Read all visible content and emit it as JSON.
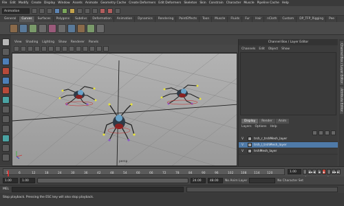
{
  "menubar": [
    "File",
    "Edit",
    "Modify",
    "Create",
    "Display",
    "Window",
    "Assets",
    "Animate",
    "Geometry Cache",
    "Create Deformers",
    "Edit Deformers",
    "Skeleton",
    "Skin",
    "Constrain",
    "Character",
    "Muscle",
    "Pipeline Cache",
    "Help"
  ],
  "status_line": {
    "mode": "Animation"
  },
  "shelf_tabs": [
    "General",
    "Curves",
    "Surfaces",
    "Polygons",
    "Subdivs",
    "Deformation",
    "Animation",
    "Dynamics",
    "Rendering",
    "PaintEffects",
    "Toon",
    "Muscle",
    "Fluids",
    "Fur",
    "Hair",
    "nCloth",
    "Custom",
    "DP_TFP_Rigging",
    "Pee"
  ],
  "shelf_active_tab": "Curves",
  "viewport": {
    "menu": [
      "View",
      "Shading",
      "Lighting",
      "Show",
      "Renderer",
      "Panels"
    ],
    "camera_label": "persp"
  },
  "right_panel": {
    "title": "Channel Box / Layer Editor",
    "channel_menu": [
      "Channels",
      "Edit",
      "Object",
      "Show"
    ],
    "layer_tabs": [
      "Display",
      "Render",
      "Anim"
    ],
    "layer_active_tab": "Display",
    "layer_menu": [
      "Layers",
      "Options",
      "Help"
    ],
    "layers": [
      {
        "visible": "V",
        "name": "trsh_r_trshMesh_layer",
        "selected": false
      },
      {
        "visible": "V",
        "name": "trsh_l_trshMesh_layer",
        "selected": true
      },
      {
        "visible": "V",
        "name": "trshMesh_layer",
        "selected": false
      }
    ]
  },
  "side_tabs": [
    "Channel Box / Layer Editor",
    "Attribute Editor"
  ],
  "time_slider": {
    "ticks": [
      "1",
      "6",
      "12",
      "18",
      "24",
      "30",
      "36",
      "42",
      "48",
      "54",
      "60",
      "66",
      "72",
      "78",
      "84",
      "90",
      "96",
      "102",
      "108",
      "114",
      "120"
    ],
    "current_frame": "1.00",
    "playback_buttons": [
      "|◀",
      "◀◀",
      "◀|",
      "◀",
      "▶",
      "|▶",
      "▶▶",
      "▶|"
    ]
  },
  "range_slider": {
    "start": "1.00",
    "start2": "1.00",
    "end": "24.00",
    "end2": "48.00",
    "anim_layer": "No Anim Layer",
    "character_set": "No Character Set"
  },
  "command_line": {
    "label": "MEL"
  },
  "help_line": {
    "text": "Stop playback. Pressing the ESC key will also stop playback."
  }
}
